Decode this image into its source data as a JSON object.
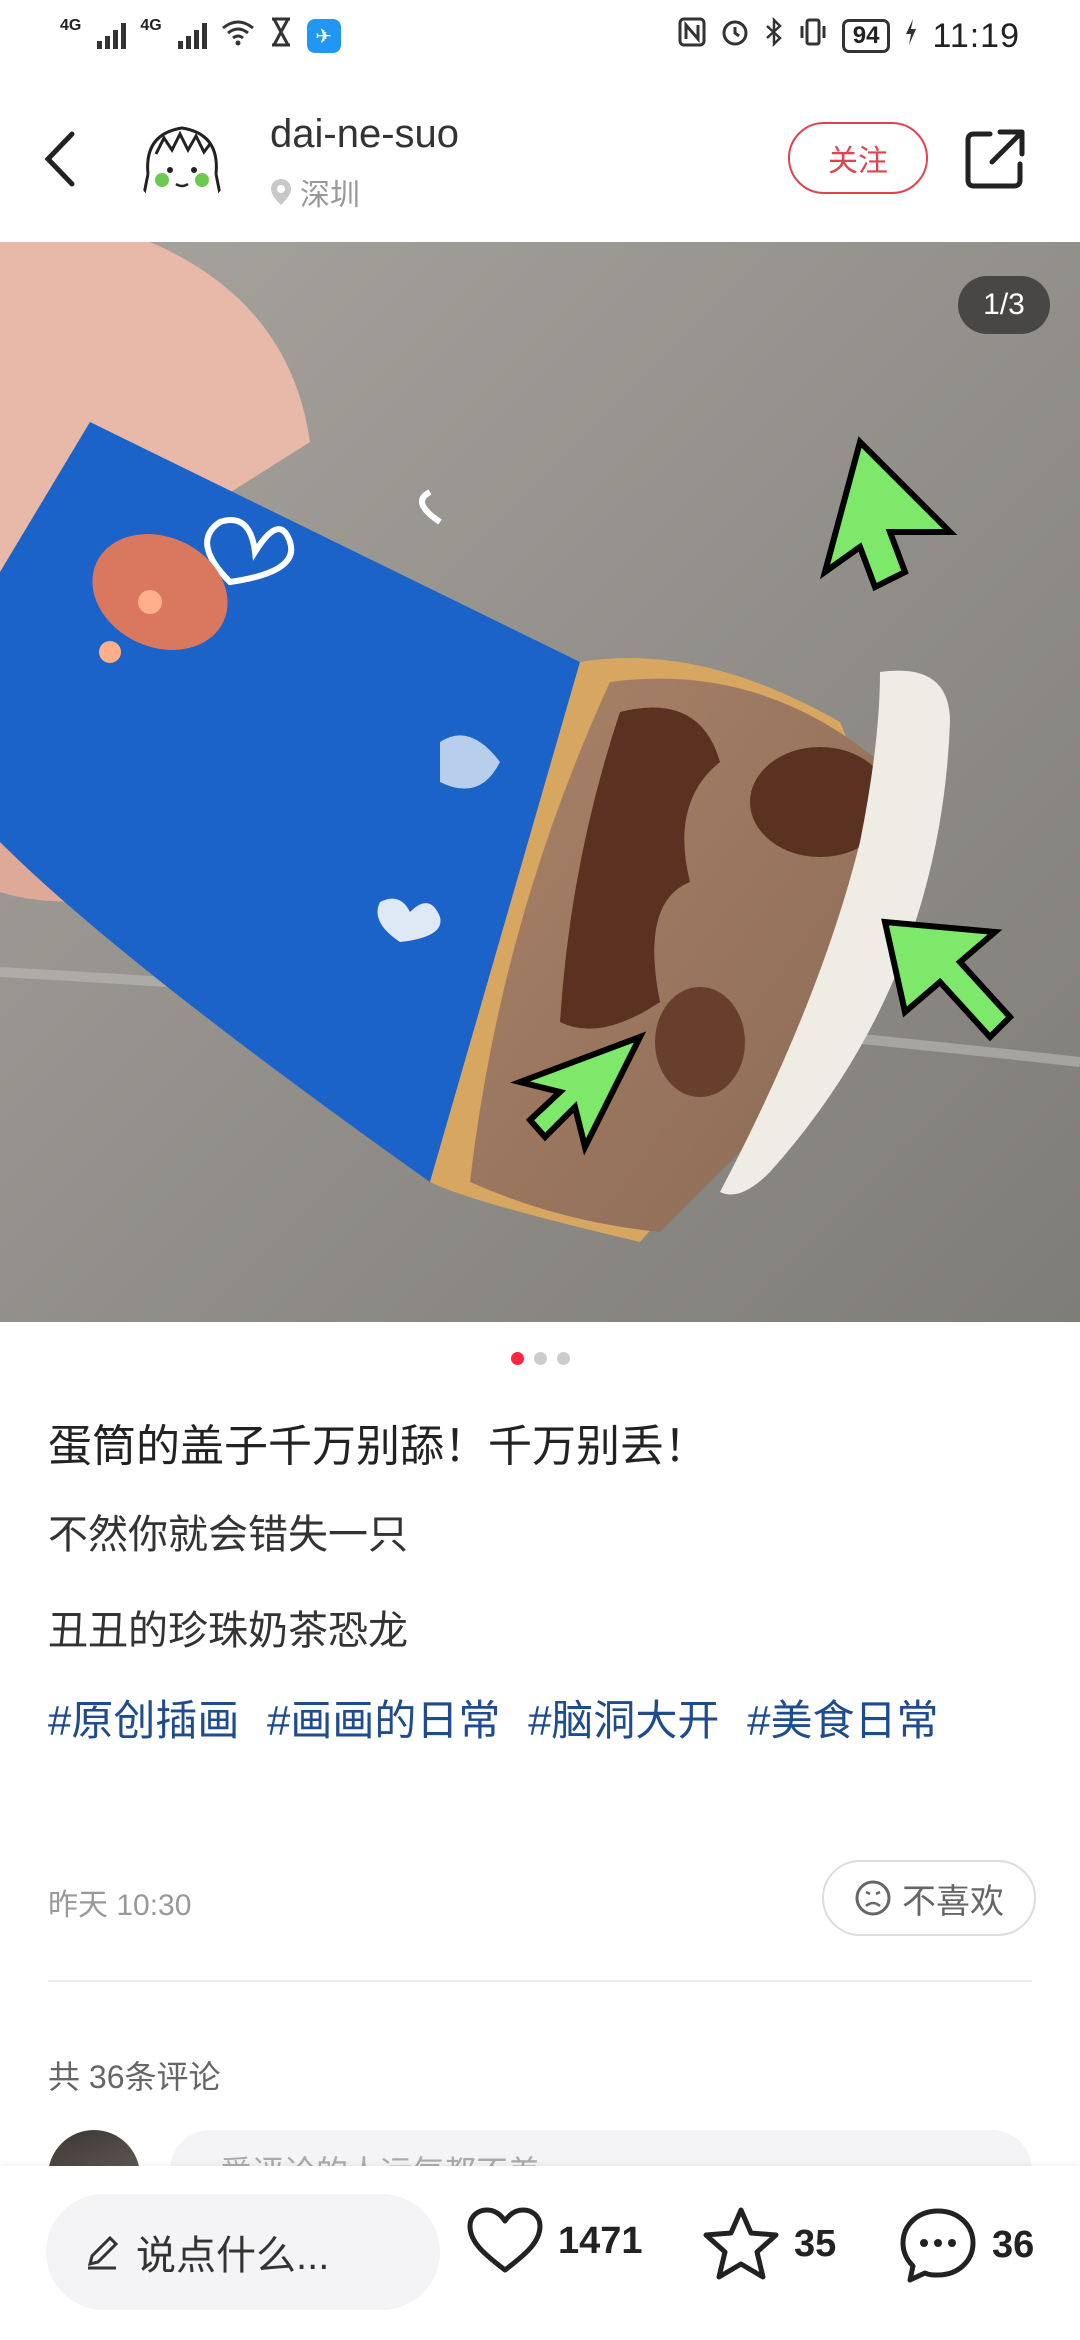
{
  "status_bar": {
    "network_1": "4G",
    "network_2": "4G",
    "battery": "94",
    "time": "11:19"
  },
  "header": {
    "username": "dai-ne-suo",
    "location": "深圳",
    "follow_label": "关注"
  },
  "image": {
    "page_counter": "1/3",
    "dots_total": 3,
    "dots_active": 1
  },
  "post": {
    "title": "蛋筒的盖子千万别舔！千万别丢！",
    "line1": "不然你就会错失一只",
    "line2": "丑丑的珍珠奶茶恐龙",
    "tags": [
      "#原创插画",
      "#画画的日常",
      "#脑洞大开",
      "#美食日常"
    ],
    "time": "昨天 10:30",
    "dislike_label": "不喜欢"
  },
  "comments": {
    "count_label": "共 36条评论",
    "input_placeholder": "爱评论的人运气都不差"
  },
  "bottom_bar": {
    "say_placeholder": "说点什么...",
    "likes": "1471",
    "stars": "35",
    "comments": "36"
  },
  "colors": {
    "accent": "#ff2442",
    "follow": "#e0434f",
    "tag": "#1f4b8f",
    "cone_blue": "#1c63c9"
  }
}
